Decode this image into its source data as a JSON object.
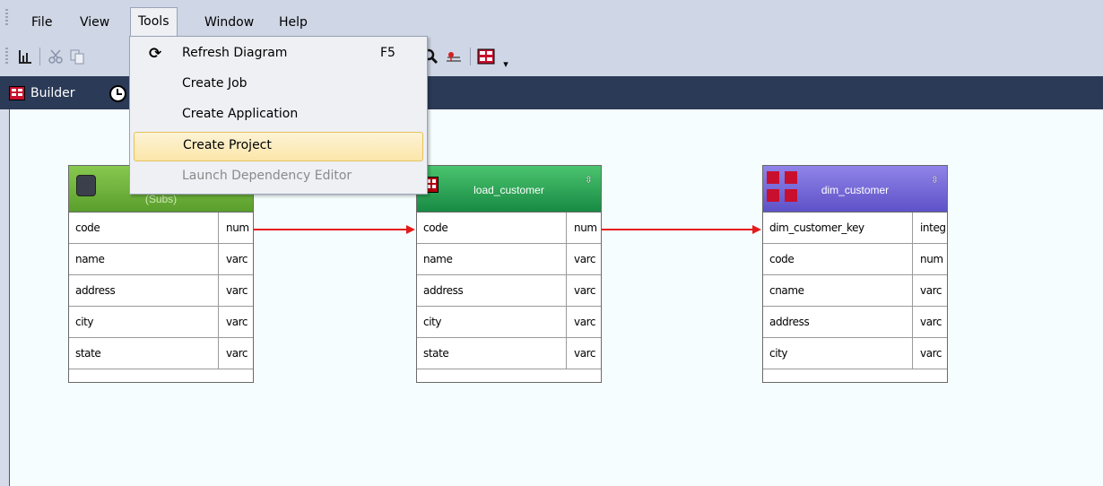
{
  "menubar": {
    "items": [
      "File",
      "View",
      "Tools",
      "Window",
      "Help"
    ],
    "active": "Tools"
  },
  "tools_menu": {
    "items": [
      {
        "label": "Refresh Diagram",
        "shortcut": "F5",
        "icon": "refresh-icon",
        "state": "normal"
      },
      {
        "label": "Create Job",
        "shortcut": "",
        "state": "normal"
      },
      {
        "label": "Create Application",
        "shortcut": "",
        "state": "normal"
      },
      {
        "label": "Create Project",
        "shortcut": "",
        "state": "hover"
      },
      {
        "label": "Launch Dependency Editor",
        "shortcut": "",
        "state": "disabled"
      }
    ]
  },
  "tabs": {
    "builder_label": "Builder"
  },
  "diagram": {
    "entities": [
      {
        "name": "(Subs)",
        "icon": "database-icon",
        "columns": [
          {
            "name": "code",
            "type": "num"
          },
          {
            "name": "name",
            "type": "varc"
          },
          {
            "name": "address",
            "type": "varc"
          },
          {
            "name": "city",
            "type": "varc"
          },
          {
            "name": "state",
            "type": "varc"
          }
        ]
      },
      {
        "name": "load_customer",
        "icon": "load-table-icon",
        "columns": [
          {
            "name": "code",
            "type": "num"
          },
          {
            "name": "name",
            "type": "varc"
          },
          {
            "name": "address",
            "type": "varc"
          },
          {
            "name": "city",
            "type": "varc"
          },
          {
            "name": "state",
            "type": "varc"
          }
        ]
      },
      {
        "name": "dim_customer",
        "icon": "dimension-icon",
        "columns": [
          {
            "name": "dim_customer_key",
            "type": "integ"
          },
          {
            "name": "code",
            "type": "num"
          },
          {
            "name": "cname",
            "type": "varc"
          },
          {
            "name": "address",
            "type": "varc"
          },
          {
            "name": "city",
            "type": "varc"
          }
        ]
      }
    ],
    "sorter_glyph": "⇳",
    "link_color": "#e41b1b"
  }
}
